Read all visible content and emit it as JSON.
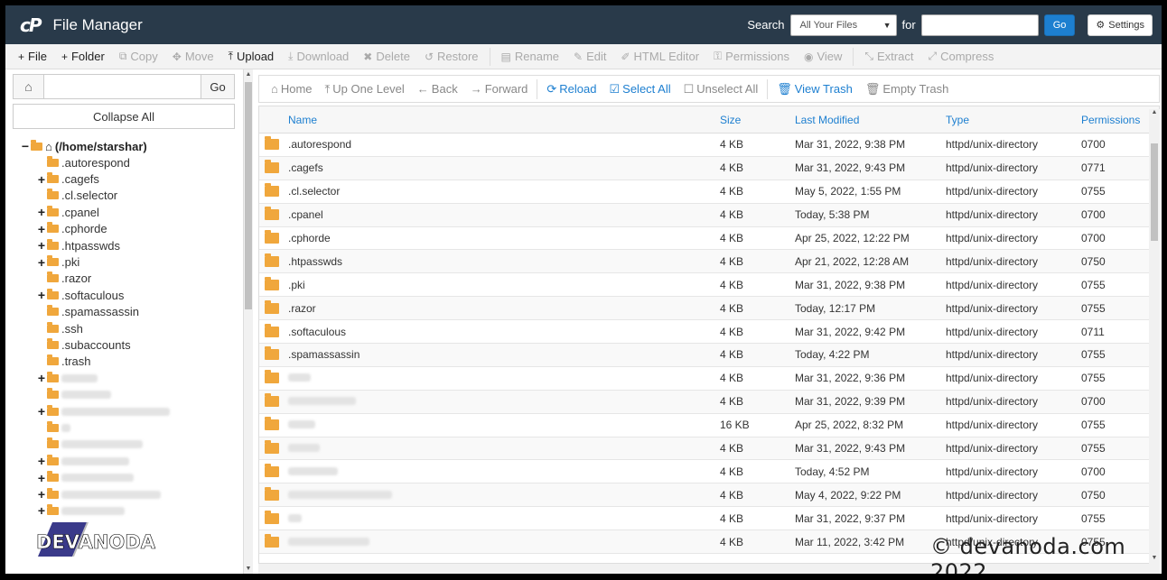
{
  "header": {
    "logo_text": "cP",
    "title": "File Manager",
    "search_label": "Search",
    "search_scope": "All Your Files",
    "for_label": "for",
    "search_value": "",
    "go_label": "Go",
    "settings_label": "Settings"
  },
  "toolbar": [
    {
      "name": "file",
      "label": "File",
      "icon": "+",
      "active": true
    },
    {
      "name": "folder",
      "label": "Folder",
      "icon": "+",
      "active": true
    },
    {
      "name": "copy",
      "label": "Copy",
      "icon": "⧉",
      "active": false
    },
    {
      "name": "move",
      "label": "Move",
      "icon": "✥",
      "active": false
    },
    {
      "name": "upload",
      "label": "Upload",
      "icon": "⤒",
      "active": true
    },
    {
      "name": "download",
      "label": "Download",
      "icon": "⤓",
      "active": false
    },
    {
      "name": "delete",
      "label": "Delete",
      "icon": "✖",
      "active": false
    },
    {
      "name": "restore",
      "label": "Restore",
      "icon": "↺",
      "active": false
    },
    {
      "name": "rename",
      "label": "Rename",
      "icon": "▤",
      "active": false
    },
    {
      "name": "edit",
      "label": "Edit",
      "icon": "✎",
      "active": false
    },
    {
      "name": "html-editor",
      "label": "HTML Editor",
      "icon": "✐",
      "active": false
    },
    {
      "name": "permissions",
      "label": "Permissions",
      "icon": "⚿",
      "active": false
    },
    {
      "name": "view",
      "label": "View",
      "icon": "◉",
      "active": false
    },
    {
      "name": "extract",
      "label": "Extract",
      "icon": "⤡",
      "active": false
    },
    {
      "name": "compress",
      "label": "Compress",
      "icon": "⤢",
      "active": false
    }
  ],
  "sidebar": {
    "path_value": "",
    "go_label": "Go",
    "collapse_label": "Collapse All",
    "root_label": "(/home/starshar)",
    "items": [
      {
        "label": ".autorespond",
        "expandable": false
      },
      {
        "label": ".cagefs",
        "expandable": true
      },
      {
        "label": ".cl.selector",
        "expandable": false
      },
      {
        "label": ".cpanel",
        "expandable": true
      },
      {
        "label": ".cphorde",
        "expandable": true
      },
      {
        "label": ".htpasswds",
        "expandable": true
      },
      {
        "label": ".pki",
        "expandable": true
      },
      {
        "label": ".razor",
        "expandable": false
      },
      {
        "label": ".softaculous",
        "expandable": true
      },
      {
        "label": ".spamassassin",
        "expandable": false
      },
      {
        "label": ".ssh",
        "expandable": false
      },
      {
        "label": ".subaccounts",
        "expandable": false
      },
      {
        "label": ".trash",
        "expandable": false
      },
      {
        "label": "",
        "expandable": true,
        "blurred": true,
        "w": 40
      },
      {
        "label": "",
        "expandable": false,
        "blurred": true,
        "w": 55
      },
      {
        "label": "",
        "expandable": true,
        "blurred": true,
        "w": 120
      },
      {
        "label": "",
        "expandable": false,
        "blurred": true,
        "w": 10
      },
      {
        "label": "",
        "expandable": false,
        "blurred": true,
        "w": 90
      },
      {
        "label": "",
        "expandable": true,
        "blurred": true,
        "w": 75
      },
      {
        "label": "",
        "expandable": true,
        "blurred": true,
        "w": 80
      },
      {
        "label": "",
        "expandable": true,
        "blurred": true,
        "w": 110
      },
      {
        "label": "",
        "expandable": true,
        "blurred": true,
        "w": 70
      }
    ]
  },
  "navbar": [
    {
      "name": "home",
      "label": "Home",
      "icon": "⌂",
      "color": "gray"
    },
    {
      "name": "up-one-level",
      "label": "Up One Level",
      "icon": "⤒",
      "color": "gray"
    },
    {
      "name": "back",
      "label": "Back",
      "icon": "←",
      "color": "gray"
    },
    {
      "name": "forward",
      "label": "Forward",
      "icon": "→",
      "color": "gray"
    },
    {
      "name": "reload",
      "label": "Reload",
      "icon": "⟳",
      "color": "blue"
    },
    {
      "name": "select-all",
      "label": "Select All",
      "icon": "☑",
      "color": "blue"
    },
    {
      "name": "unselect-all",
      "label": "Unselect All",
      "icon": "☐",
      "color": "gray"
    },
    {
      "name": "view-trash",
      "label": "View Trash",
      "icon": "🗑",
      "color": "blue"
    },
    {
      "name": "empty-trash",
      "label": "Empty Trash",
      "icon": "🗑",
      "color": "gray"
    }
  ],
  "table": {
    "columns": {
      "name": "Name",
      "size": "Size",
      "modified": "Last Modified",
      "type": "Type",
      "permissions": "Permissions"
    },
    "rows": [
      {
        "name": ".autorespond",
        "size": "4 KB",
        "modified": "Mar 31, 2022, 9:38 PM",
        "type": "httpd/unix-directory",
        "perm": "0700"
      },
      {
        "name": ".cagefs",
        "size": "4 KB",
        "modified": "Mar 31, 2022, 9:43 PM",
        "type": "httpd/unix-directory",
        "perm": "0771"
      },
      {
        "name": ".cl.selector",
        "size": "4 KB",
        "modified": "May 5, 2022, 1:55 PM",
        "type": "httpd/unix-directory",
        "perm": "0755"
      },
      {
        "name": ".cpanel",
        "size": "4 KB",
        "modified": "Today, 5:38 PM",
        "type": "httpd/unix-directory",
        "perm": "0700"
      },
      {
        "name": ".cphorde",
        "size": "4 KB",
        "modified": "Apr 25, 2022, 12:22 PM",
        "type": "httpd/unix-directory",
        "perm": "0700"
      },
      {
        "name": ".htpasswds",
        "size": "4 KB",
        "modified": "Apr 21, 2022, 12:28 AM",
        "type": "httpd/unix-directory",
        "perm": "0750"
      },
      {
        "name": ".pki",
        "size": "4 KB",
        "modified": "Mar 31, 2022, 9:38 PM",
        "type": "httpd/unix-directory",
        "perm": "0755"
      },
      {
        "name": ".razor",
        "size": "4 KB",
        "modified": "Today, 12:17 PM",
        "type": "httpd/unix-directory",
        "perm": "0755"
      },
      {
        "name": ".softaculous",
        "size": "4 KB",
        "modified": "Mar 31, 2022, 9:42 PM",
        "type": "httpd/unix-directory",
        "perm": "0711"
      },
      {
        "name": ".spamassassin",
        "size": "4 KB",
        "modified": "Today, 4:22 PM",
        "type": "httpd/unix-directory",
        "perm": "0755"
      },
      {
        "name": "",
        "size": "4 KB",
        "modified": "Mar 31, 2022, 9:36 PM",
        "type": "httpd/unix-directory",
        "perm": "0755",
        "blurred": true,
        "w": 25
      },
      {
        "name": "",
        "size": "4 KB",
        "modified": "Mar 31, 2022, 9:39 PM",
        "type": "httpd/unix-directory",
        "perm": "0700",
        "blurred": true,
        "w": 75
      },
      {
        "name": "",
        "size": "16 KB",
        "modified": "Apr 25, 2022, 8:32 PM",
        "type": "httpd/unix-directory",
        "perm": "0755",
        "blurred": true,
        "w": 30
      },
      {
        "name": "",
        "size": "4 KB",
        "modified": "Mar 31, 2022, 9:43 PM",
        "type": "httpd/unix-directory",
        "perm": "0755",
        "blurred": true,
        "w": 35
      },
      {
        "name": "",
        "size": "4 KB",
        "modified": "Today, 4:52 PM",
        "type": "httpd/unix-directory",
        "perm": "0700",
        "blurred": true,
        "w": 55
      },
      {
        "name": "",
        "size": "4 KB",
        "modified": "May 4, 2022, 9:22 PM",
        "type": "httpd/unix-directory",
        "perm": "0750",
        "blurred": true,
        "w": 115
      },
      {
        "name": "",
        "size": "4 KB",
        "modified": "Mar 31, 2022, 9:37 PM",
        "type": "httpd/unix-directory",
        "perm": "0755",
        "blurred": true,
        "w": 15
      },
      {
        "name": "",
        "size": "4 KB",
        "modified": "Mar 11, 2022, 3:42 PM",
        "type": "httpd/unix-directory",
        "perm": "0755",
        "blurred": true,
        "w": 90
      }
    ]
  },
  "watermark": {
    "logo_text": "DEVANODA",
    "copyright_text": "© devanoda.com 2022"
  },
  "colors": {
    "header_bg": "#293a4a",
    "accent": "#1d7fd0",
    "folder": "#f0a73c"
  }
}
